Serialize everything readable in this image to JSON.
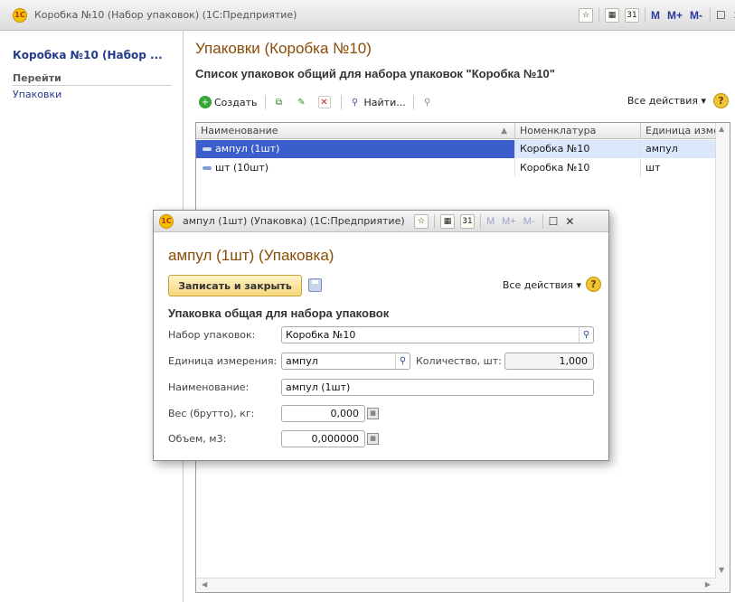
{
  "window": {
    "title": "Коробка №10 (Набор упаковок)  (1С:Предприятие)",
    "logo": "1С",
    "toolbar_m": "M",
    "toolbar_mplus": "M+",
    "toolbar_mminus": "M-",
    "calendar_label": "31"
  },
  "sidebar": {
    "title": "Коробка №10 (Набор ...",
    "goto_label": "Перейти",
    "items": [
      {
        "label": "Упаковки"
      }
    ]
  },
  "content": {
    "title": "Упаковки (Коробка №10)",
    "subtitle": "Список упаковок общий для набора упаковок \"Коробка №10\"",
    "toolbar": {
      "create_label": "Создать",
      "find_label": "Найти...",
      "all_actions_label": "Все действия ▾",
      "help_label": "?"
    },
    "table": {
      "columns": [
        "Наименование",
        "Номенклатура",
        "Единица изме"
      ],
      "rows": [
        {
          "name": "ампул (1шт)",
          "nomenclature": "Коробка №10",
          "unit": "ампул",
          "selected": true
        },
        {
          "name": "шт (10шт)",
          "nomenclature": "Коробка №10",
          "unit": "шт",
          "selected": false
        }
      ]
    }
  },
  "dialog": {
    "title": "ампул (1шт) (Упаковка)  (1С:Предприятие)",
    "heading": "ампул (1шт) (Упаковка)",
    "save_close_label": "Записать и закрыть",
    "all_actions_label": "Все действия ▾",
    "help_label": "?",
    "section_title": "Упаковка общая для набора упаковок",
    "fields": {
      "set_label": "Набор упаковок:",
      "set_value": "Коробка №10",
      "unit_label": "Единица измерения:",
      "unit_value": "ампул",
      "qty_label": "Количество, шт:",
      "qty_value": "1,000",
      "name_label": "Наименование:",
      "name_value": "ампул (1шт)",
      "weight_label": "Вес (брутто), кг:",
      "weight_value": "0,000",
      "volume_label": "Объем, м3:",
      "volume_value": "0,000000"
    }
  }
}
